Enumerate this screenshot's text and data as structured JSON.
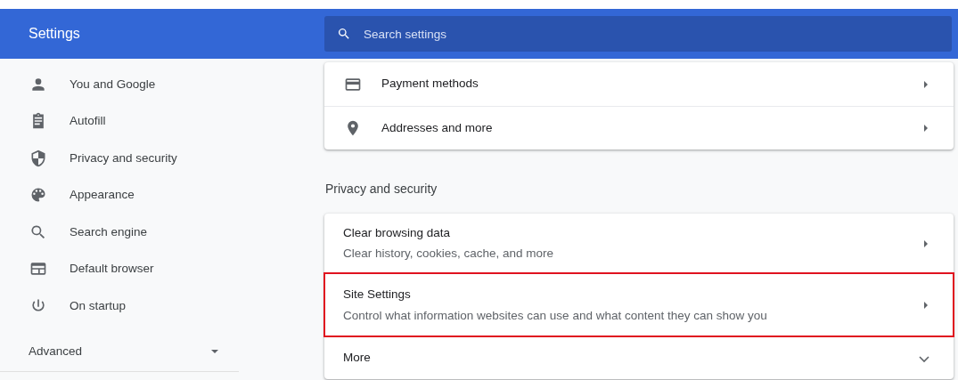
{
  "header": {
    "title": "Settings",
    "search": {
      "placeholder": "Search settings"
    }
  },
  "sidebar": {
    "items": [
      {
        "label": "You and Google",
        "selected": false
      },
      {
        "label": "Autofill",
        "selected": false
      },
      {
        "label": "Privacy and security",
        "selected": false
      },
      {
        "label": "Appearance",
        "selected": false
      },
      {
        "label": "Search engine",
        "selected": false
      },
      {
        "label": "Default browser",
        "selected": false
      },
      {
        "label": "On startup",
        "selected": false
      }
    ],
    "advanced": {
      "label": "Advanced",
      "expanded": false
    }
  },
  "autofill_rows": [
    {
      "label": "Payment methods"
    },
    {
      "label": "Addresses and more"
    }
  ],
  "privacy_section": {
    "title": "Privacy and security",
    "rows": [
      {
        "kind": "link",
        "title": "Clear browsing data",
        "subtitle": "Clear history, cookies, cache, and more",
        "highlighted": false
      },
      {
        "kind": "link",
        "title": "Site Settings",
        "subtitle": "Control what information websites can use and what content they can show you",
        "highlighted": true
      },
      {
        "kind": "expand",
        "title": "More",
        "expanded": false
      }
    ]
  }
}
